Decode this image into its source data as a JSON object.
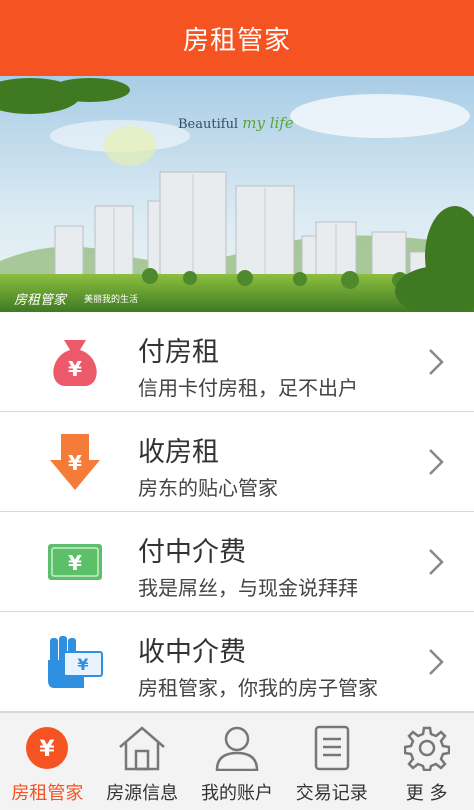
{
  "header": {
    "title": "房租管家"
  },
  "banner": {
    "title_prefix": "Beautiful",
    "title_suffix": "my life",
    "brand": "房租管家",
    "slogan": "美丽我的生活"
  },
  "menu": {
    "items": [
      {
        "title": "付房租",
        "subtitle": "信用卡付房租，足不出户",
        "icon": "money-bag-icon",
        "color": "#ec5a6a"
      },
      {
        "title": "收房租",
        "subtitle": "房东的贴心管家",
        "icon": "down-arrow-yuan-icon",
        "color": "#f47c38"
      },
      {
        "title": "付中介费",
        "subtitle": "我是屌丝，与现金说拜拜",
        "icon": "banknote-icon",
        "color": "#5cc06a"
      },
      {
        "title": "收中介费",
        "subtitle": "房租管家，你我的房子管家",
        "icon": "hand-cash-icon",
        "color": "#2f8fe0"
      }
    ]
  },
  "tabbar": {
    "tabs": [
      {
        "label": "房租管家",
        "icon": "yuan-circle-icon",
        "active": true
      },
      {
        "label": "房源信息",
        "icon": "house-icon",
        "active": false
      },
      {
        "label": "我的账户",
        "icon": "user-icon",
        "active": false
      },
      {
        "label": "交易记录",
        "icon": "document-icon",
        "active": false
      },
      {
        "label": "更 多",
        "icon": "gear-icon",
        "active": false
      }
    ]
  },
  "colors": {
    "accent": "#f55322",
    "tab_bg": "#f3f3f3"
  }
}
